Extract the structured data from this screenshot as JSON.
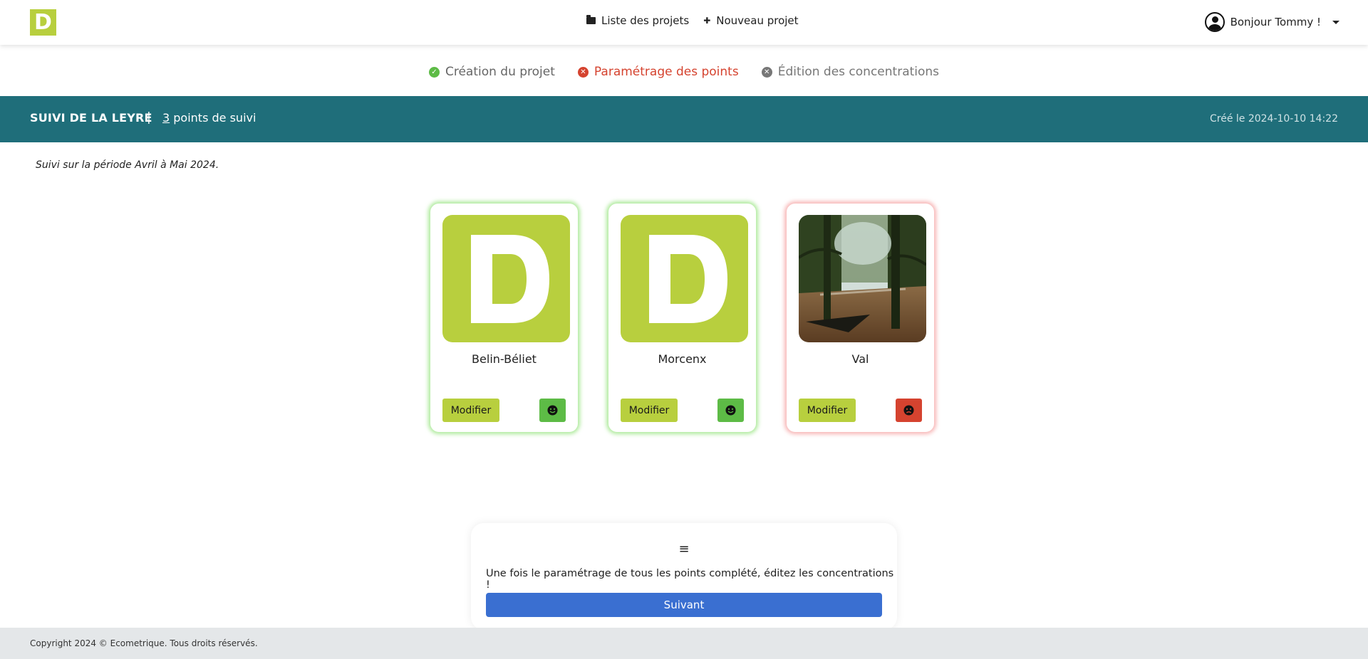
{
  "navbar": {
    "logo_letter": "D",
    "links": [
      {
        "icon": "folder-icon",
        "label": "Liste des projets"
      },
      {
        "icon": "plus-icon",
        "label": "Nouveau projet"
      }
    ],
    "user_greeting": "Bonjour Tommy !"
  },
  "stepper": {
    "steps": [
      {
        "label": "Création du projet",
        "status": "done"
      },
      {
        "label": "Paramétrage des points",
        "status": "error"
      },
      {
        "label": "Édition des concentrations",
        "status": "todo"
      }
    ]
  },
  "project": {
    "title": "SUIVI DE LA LEYRE",
    "separator": "|",
    "point_count": "3",
    "point_count_suffix": " points de suivi",
    "created": "Créé le 2024-10-10 14:22",
    "period": "Suivi sur la période Avril à Mai 2024."
  },
  "points": [
    {
      "name": "Belin-Béliet",
      "image": "logo-placeholder",
      "status": "ok",
      "edit_label": "Modifier"
    },
    {
      "name": "Morcenx",
      "image": "logo-placeholder",
      "status": "ok",
      "edit_label": "Modifier"
    },
    {
      "name": "Val",
      "image": "river-photo",
      "status": "bad",
      "edit_label": "Modifier"
    }
  ],
  "panel": {
    "handle_icon": "≡",
    "message": "Une fois le paramétrage de tous les points complété, éditez les concentrations !",
    "next_label": "Suivant"
  },
  "footer": {
    "copyright": "Copyright 2024 © Ecometrique. Tous droits réservés."
  },
  "colors": {
    "brand": "#b8cf3e",
    "band": "#1f6e7a",
    "ok": "#5dbb46",
    "error": "#d5432f",
    "primary": "#3a6fd1"
  }
}
